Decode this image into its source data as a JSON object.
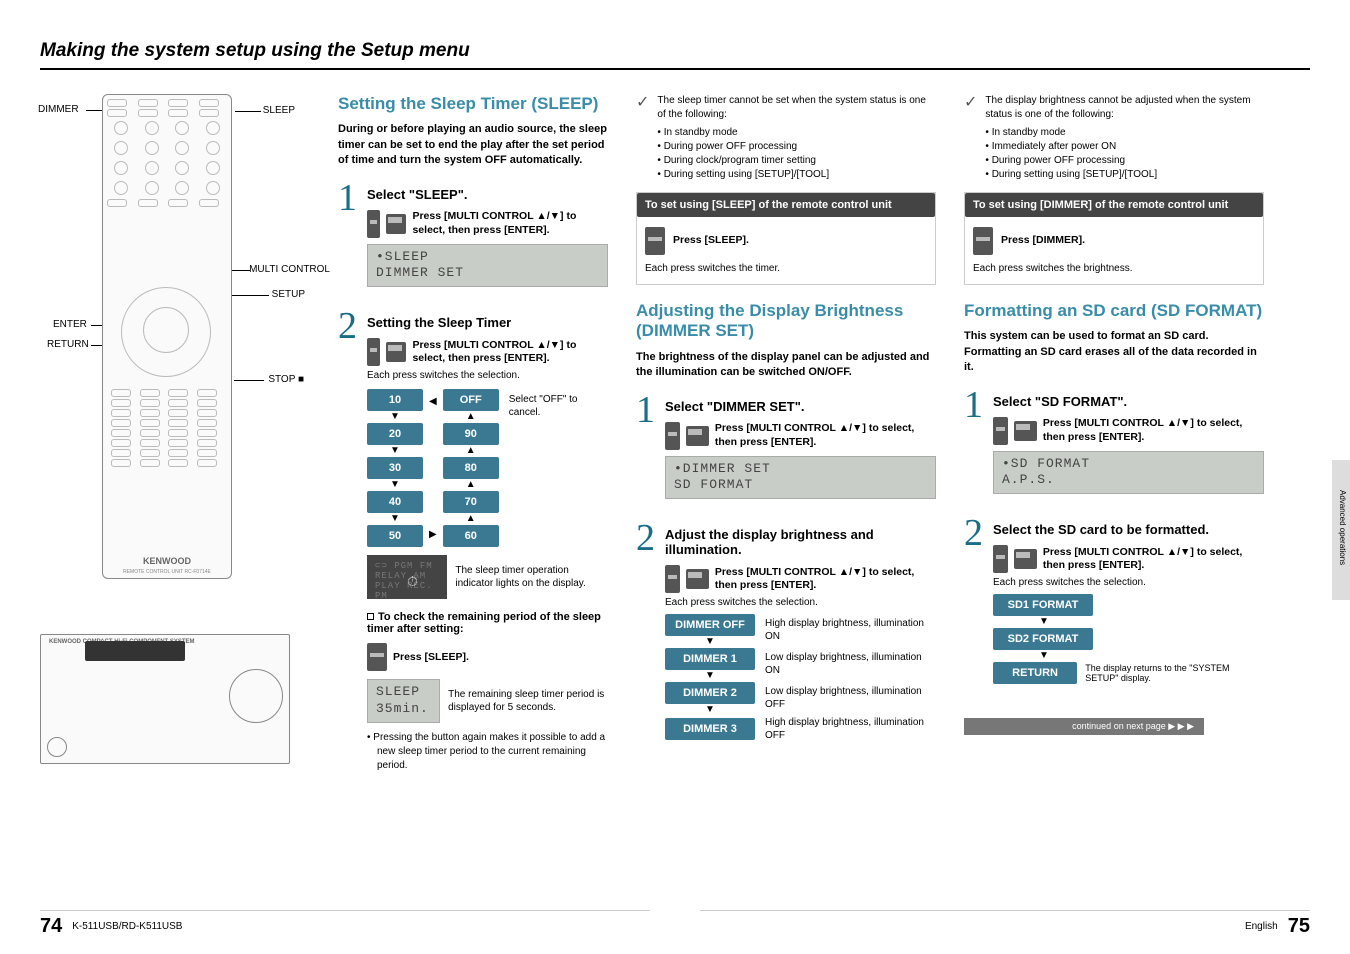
{
  "page_title": "Making the system setup using the Setup menu",
  "remote_labels": {
    "dimmer": "DIMMER",
    "sleep": "SLEEP",
    "multi": "MULTI CONTROL",
    "setup": "SETUP",
    "enter": "ENTER",
    "return": "RETURN",
    "stop": "STOP ■"
  },
  "remote_logo": "KENWOOD",
  "remote_sub": "REMOTE CONTROL UNIT RC-F0714E",
  "unit_logo": "KENWOOD  COMPACT Hi-Fi COMPONENT SYSTEM",
  "sleep": {
    "title": "Setting the Sleep Timer (SLEEP)",
    "intro": "During or before playing an audio source, the sleep timer can be set to end the play after the set period of time and turn the system OFF automatically.",
    "step1_label": "Select \"SLEEP\".",
    "press_text": "Press [MULTI CONTROL ▲/▼] to select, then press [ENTER].",
    "lcd1_line1": "•SLEEP",
    "lcd1_line2": "  DIMMER SET",
    "step2_label": "Setting the Sleep Timer",
    "each_press": "Each press switches the selection.",
    "options_left": [
      "10",
      "20",
      "30",
      "40",
      "50"
    ],
    "options_right": [
      "OFF",
      "90",
      "80",
      "70",
      "60"
    ],
    "cancel_note": "Select \"OFF\" to cancel.",
    "indicator_note": "The sleep timer operation indicator lights on the display.",
    "check_heading": "To check the remaining period of the sleep timer after setting:",
    "press_sleep": "Press [SLEEP].",
    "remain_lcd_l1": "SLEEP",
    "remain_lcd_l2": "35min.",
    "remain_note": "The remaining sleep timer period is displayed for 5 seconds.",
    "again_note": "Pressing the button again makes it possible to add a new sleep timer period to the current remaining period."
  },
  "sleep_check": {
    "intro": "The sleep timer cannot be set when the system status is one of the following:",
    "items": [
      "In standby mode",
      "During power OFF processing",
      "During clock/program timer setting",
      "During setting using [SETUP]/[TOOL]"
    ]
  },
  "sleep_callout": {
    "bar": "To set using [SLEEP] of the remote control unit",
    "press": "Press [SLEEP].",
    "sub": "Each press switches the timer."
  },
  "dimmer": {
    "title": "Adjusting the Display Brightness (DIMMER SET)",
    "intro": "The brightness of the display panel can be adjusted and the illumination can be switched ON/OFF.",
    "step1_label": "Select \"DIMMER SET\".",
    "press_text": "Press [MULTI CONTROL ▲/▼] to select, then press [ENTER].",
    "lcd_l1": "•DIMMER SET",
    "lcd_l2": "  SD FORMAT",
    "step2_label": "Adjust the display brightness and illumination.",
    "each_press": "Each press switches the selection.",
    "options": [
      {
        "label": "DIMMER OFF",
        "desc": "High display brightness, illumination ON"
      },
      {
        "label": "DIMMER 1",
        "desc": "Low display brightness, illumination ON"
      },
      {
        "label": "DIMMER 2",
        "desc": "Low display brightness, illumination OFF"
      },
      {
        "label": "DIMMER 3",
        "desc": "High display brightness, illumination OFF"
      }
    ]
  },
  "dimmer_check": {
    "intro": "The display brightness cannot be adjusted when the system status is one of the following:",
    "items": [
      "In standby mode",
      "Immediately after power ON",
      "During power OFF processing",
      "During setting using [SETUP]/[TOOL]"
    ]
  },
  "dimmer_callout": {
    "bar": "To set using [DIMMER] of the remote control unit",
    "press": "Press [DIMMER].",
    "sub": "Each press switches the brightness."
  },
  "sdformat": {
    "title": "Formatting an SD card (SD FORMAT)",
    "intro": "This system can be used to format an SD card. Formatting an SD card erases all of the data recorded in it.",
    "step1_label": "Select \"SD FORMAT\".",
    "press_text": "Press [MULTI CONTROL ▲/▼] to select, then press [ENTER].",
    "lcd_l1": "•SD FORMAT",
    "lcd_l2": "  A.P.S.",
    "step2_label": "Select the SD card to be formatted.",
    "each_press": "Each press switches the selection.",
    "options": [
      "SD1 FORMAT",
      "SD2 FORMAT",
      "RETURN"
    ],
    "return_note": "The display returns to the \"SYSTEM SETUP\" display."
  },
  "side_tab": "Advanced operations",
  "continued": "continued on next page  ▶ ▶ ▶",
  "footer": {
    "model": "K-511USB/RD-K511USB",
    "lang": "English",
    "page_left": "74",
    "page_right": "75"
  },
  "indicator_lines": {
    "l1": "⊂⊃  PGM      FM",
    "l2": "RELAY        AM",
    "l3": "PLAY REC.    PM"
  }
}
